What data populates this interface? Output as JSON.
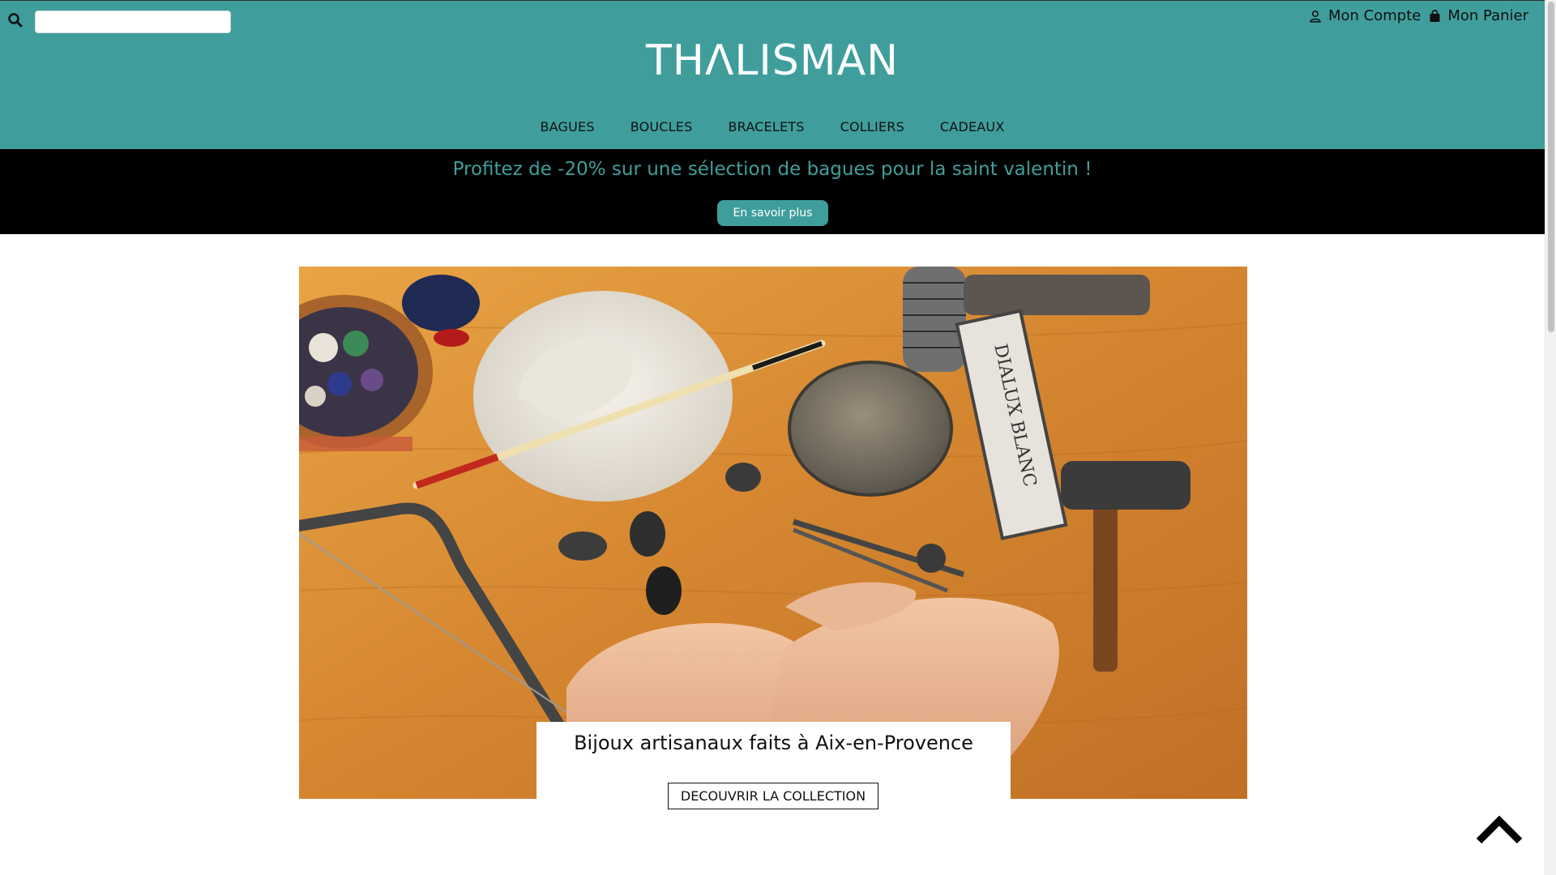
{
  "header": {
    "search": {
      "value": "",
      "placeholder": ""
    },
    "account_label": "Mon Compte",
    "cart_label": "Mon Panier",
    "logo_text": "THΛLISMAN",
    "nav": [
      "BAGUES",
      "BOUCLES",
      "BRACELETS",
      "COLLIERS",
      "CADEAUX"
    ]
  },
  "promo": {
    "text": "Profitez de -20% sur une sélection de bagues pour la saint valentin !",
    "button_label": "En savoir plus"
  },
  "hero": {
    "title": "Bijoux artisanaux faits à Aix-en-Provence",
    "button_label": "DECOUVRIR LA COLLECTION",
    "stamp_text": "DIALUX BLANC"
  },
  "colors": {
    "brand_teal": "#3f9e9b",
    "banner_black": "#000000",
    "text_dark": "#111111"
  },
  "icons": {
    "search": "search-icon",
    "account": "user-icon",
    "cart": "shopping-bag-icon",
    "back_to_top": "chevron-up-icon"
  }
}
